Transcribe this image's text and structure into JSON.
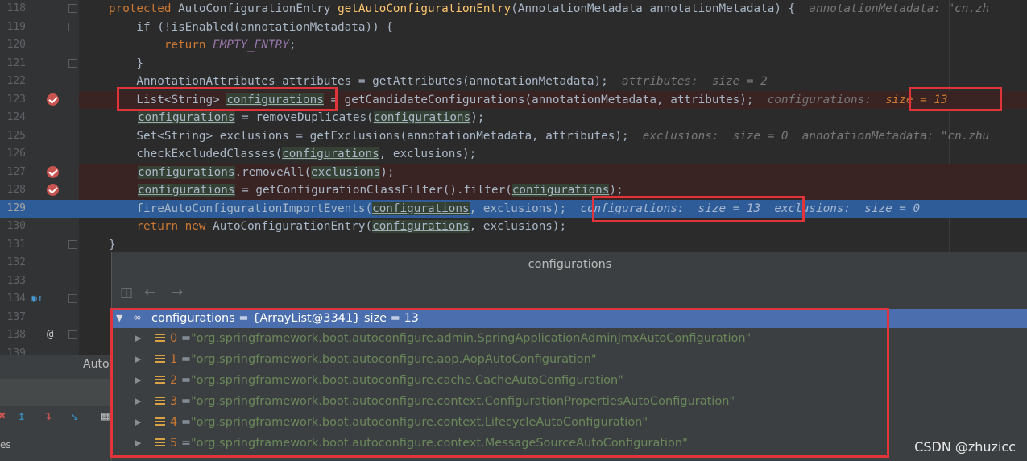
{
  "gutter": {
    "lines": [
      {
        "n": "118",
        "marker": "fold"
      },
      {
        "n": "119",
        "marker": "fold"
      },
      {
        "n": "120",
        "marker": ""
      },
      {
        "n": "121",
        "marker": "fold"
      },
      {
        "n": "122",
        "marker": ""
      },
      {
        "n": "123",
        "marker": "breakpoint"
      },
      {
        "n": "124",
        "marker": ""
      },
      {
        "n": "125",
        "marker": ""
      },
      {
        "n": "126",
        "marker": ""
      },
      {
        "n": "127",
        "marker": "breakpoint"
      },
      {
        "n": "128",
        "marker": "breakpoint"
      },
      {
        "n": "129",
        "marker": "current"
      },
      {
        "n": "130",
        "marker": ""
      },
      {
        "n": "131",
        "marker": "fold"
      },
      {
        "n": "132",
        "marker": ""
      },
      {
        "n": "133",
        "marker": ""
      },
      {
        "n": "134",
        "marker": "override"
      },
      {
        "n": "137",
        "marker": ""
      },
      {
        "n": "138",
        "marker": "annotation"
      },
      {
        "n": "139",
        "marker": ""
      }
    ]
  },
  "code": {
    "l118": {
      "kw": "protected ",
      "t1": "AutoConfigurationEntry ",
      "fn": "getAutoConfigurationEntry",
      "t2": "(AnnotationMetadata annotationMetadata) {  ",
      "hint": "annotationMetadata: \"cn.zh"
    },
    "l119": {
      "t1": "    if (!isEnabled(annotationMetadata)) {"
    },
    "l120": {
      "kw": "        return ",
      "const": "EMPTY_ENTRY",
      "t2": ";"
    },
    "l121": {
      "t1": "    }"
    },
    "l122": {
      "t1": "    AnnotationAttributes attributes = getAttributes(annotationMetadata);  ",
      "hint": "attributes:  size = 2"
    },
    "l123": {
      "t1": "    List<String> ",
      "v1": "configurations",
      "t2": " = getCandidateConfigurations(annotationMetadata, attributes);  ",
      "hint": "configurations:  ",
      "hint2": "size = 13"
    },
    "l124": {
      "v1": "configurations",
      "t1": " = removeDuplicates(",
      "v2": "configurations",
      "t2": ");"
    },
    "l125": {
      "t1": "    Set<String> exclusions = getExclusions(annotationMetadata, attributes);  ",
      "hint": "exclusions:  size = 0  annotationMetadata: \"cn.zhu"
    },
    "l126": {
      "t1": "    checkExcludedClasses(",
      "v1": "configurations",
      "t2": ", exclusions);"
    },
    "l127": {
      "v1": "configurations",
      "t1": ".removeAll(",
      "v2": "exclusions",
      "t2": ");"
    },
    "l128": {
      "v1": "configurations",
      "t1": " = getConfigurationClassFilter().filter(",
      "v2": "configurations",
      "t2": ");"
    },
    "l129": {
      "t1": "    fireAutoConfigurationImportEvents(",
      "v1": "configurations",
      "t2": ", exclusions);  ",
      "hint": "configurations:  size = 13  ",
      "hint2": "exclusions:  size = 0"
    },
    "l130": {
      "kw": "    return new ",
      "t1": "AutoConfigurationEntry(",
      "v1": "configurations",
      "t2": ", exclusions);"
    },
    "l131": {
      "t1": "}"
    }
  },
  "tool_window": {
    "tab_label": "Auto",
    "bottom_label": "es"
  },
  "popup": {
    "title": "configurations",
    "root": {
      "label": "configurations = {ArrayList@3341}  size = 13"
    },
    "items": [
      {
        "idx": "0",
        "eq": " = ",
        "value": "\"org.springframework.boot.autoconfigure.admin.SpringApplicationAdminJmxAutoConfiguration\""
      },
      {
        "idx": "1",
        "eq": " = ",
        "value": "\"org.springframework.boot.autoconfigure.aop.AopAutoConfiguration\""
      },
      {
        "idx": "2",
        "eq": " = ",
        "value": "\"org.springframework.boot.autoconfigure.cache.CacheAutoConfiguration\""
      },
      {
        "idx": "3",
        "eq": " = ",
        "value": "\"org.springframework.boot.autoconfigure.context.ConfigurationPropertiesAutoConfiguration\""
      },
      {
        "idx": "4",
        "eq": " = ",
        "value": "\"org.springframework.boot.autoconfigure.context.LifecycleAutoConfiguration\""
      },
      {
        "idx": "5",
        "eq": " = ",
        "value": "\"org.springframework.boot.autoconfigure.context.MessageSourceAutoConfiguration\""
      }
    ]
  },
  "watermark": "CSDN @zhuzicc",
  "colors": {
    "accent_red": "#e0343a",
    "selection_blue": "#4b6eaf",
    "current_line": "#2d5c99"
  }
}
